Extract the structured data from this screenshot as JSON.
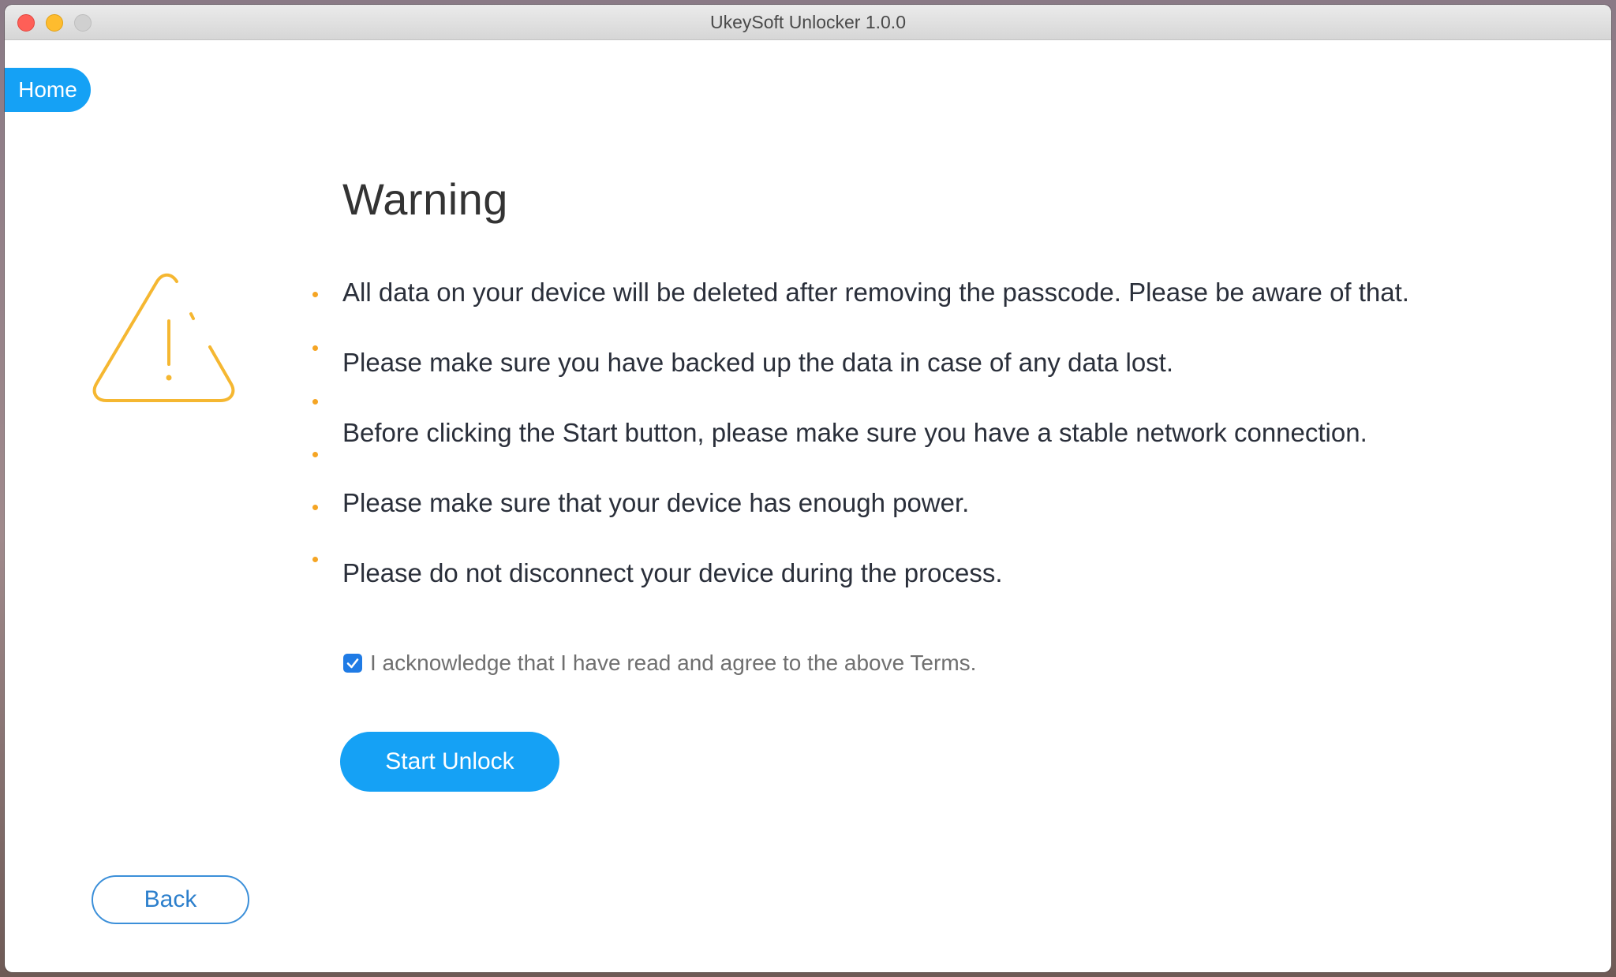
{
  "window": {
    "title": "UkeySoft Unlocker 1.0.0"
  },
  "nav": {
    "home_label": "Home"
  },
  "warning": {
    "icon": "warning-triangle-icon",
    "heading": "Warning",
    "items": [
      "All data on your device will be deleted after removing the passcode. Please be aware of that.",
      "Please make sure you have backed up the data in case of any data lost.",
      "Before clicking the Start button, please make sure you have a stable network connection.",
      "Please make sure that your device has enough power.",
      "Please do not disconnect your device during the process."
    ]
  },
  "acknowledge": {
    "checked": true,
    "label": "I acknowledge that I have read and agree to the above Terms."
  },
  "actions": {
    "start_label": "Start Unlock",
    "back_label": "Back"
  },
  "colors": {
    "accent": "#15a1f5",
    "warning": "#f5b731",
    "bullet": "#f5a524",
    "checkbox": "#1f7be5"
  }
}
